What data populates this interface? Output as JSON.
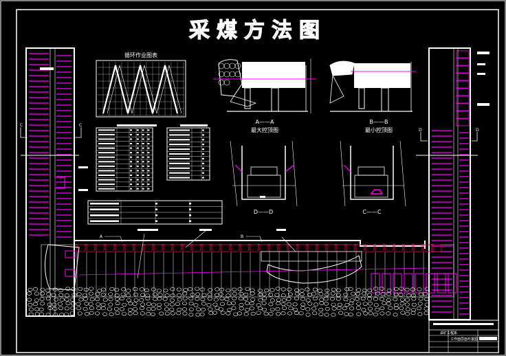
{
  "title": "采煤方法图",
  "cycle_chart": {
    "title": "循环作业图表"
  },
  "sections": {
    "aa": {
      "label": "A——A",
      "caption": "最大控顶图"
    },
    "bb": {
      "label": "B——B",
      "caption": "最小控顶图"
    },
    "dd": {
      "label": "D——D"
    },
    "cc": {
      "label": "C——C"
    }
  },
  "markers": {
    "a": "A",
    "b": "B",
    "c": "C",
    "d": "D"
  },
  "title_block": {
    "row1": "采矿工程系",
    "row2": "工作面层面布置图"
  },
  "colors": {
    "line": "#ffffff",
    "accent": "#ff00ff",
    "seam": "#c0003c",
    "background": "#000000"
  }
}
